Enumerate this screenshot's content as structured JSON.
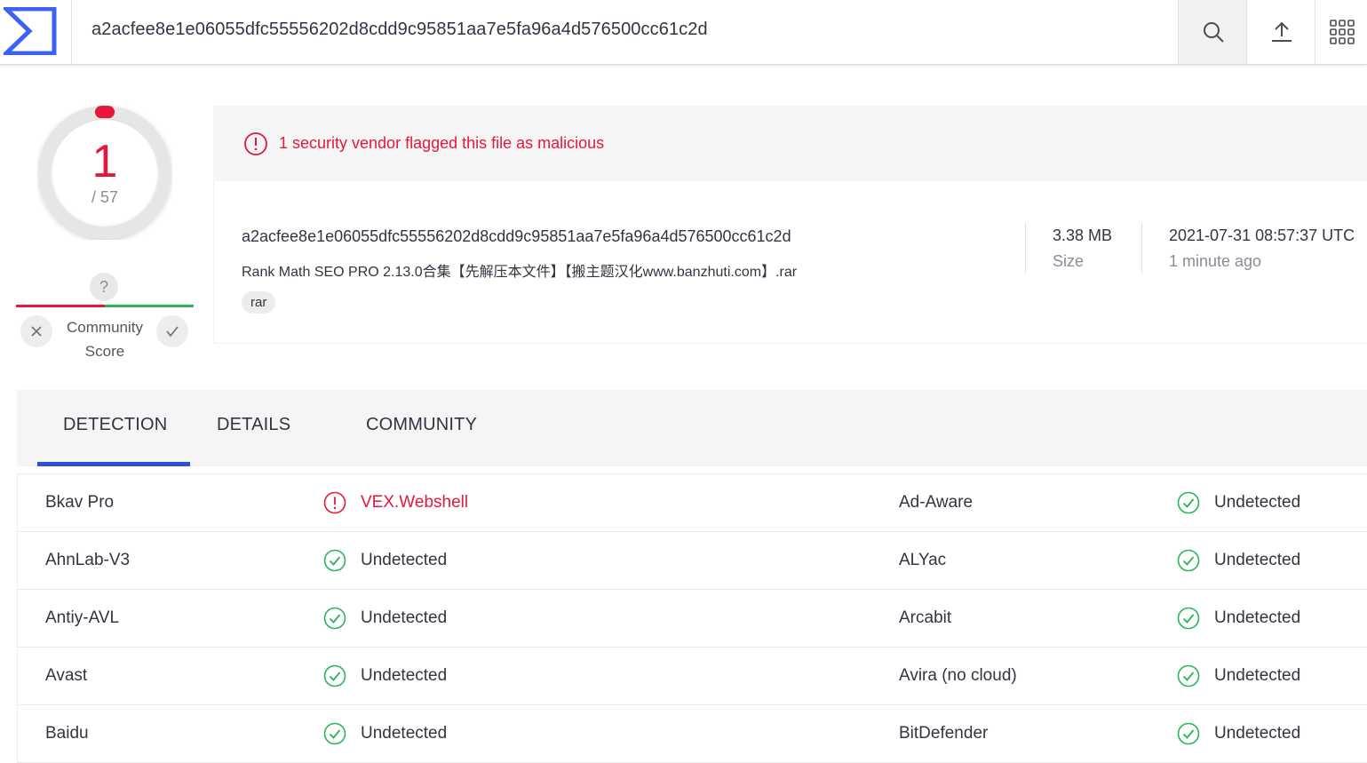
{
  "topbar": {
    "search_value": "a2acfee8e1e06055dfc55556202d8cdd9c95851aa7e5fa96a4d576500cc61c2d",
    "icons": [
      "logo-icon",
      "search-icon",
      "upload-icon",
      "apps-grid-icon"
    ]
  },
  "score": {
    "detections": "1",
    "total": "/ 57",
    "fraction": 0.0175
  },
  "community": {
    "question": "?",
    "label": "Community Score"
  },
  "alert": {
    "text": "1 security vendor flagged this file as malicious"
  },
  "file": {
    "hash": "a2acfee8e1e06055dfc55556202d8cdd9c95851aa7e5fa96a4d576500cc61c2d",
    "name": "Rank Math SEO PRO 2.13.0合集【先解压本文件】【搬主题汉化www.banzhuti.com】.rar",
    "tag": "rar",
    "size_value": "3.38 MB",
    "size_label": "Size",
    "date_value": "2021-07-31 08:57:37 UTC",
    "date_label": "1 minute ago"
  },
  "tabs": [
    "DETECTION",
    "DETAILS",
    "COMMUNITY"
  ],
  "colors": {
    "malicious": "#e5183c",
    "clean": "#2bb25a",
    "accent": "#2f4cdd"
  },
  "detections": [
    {
      "engine1": "Bkav Pro",
      "result1": "VEX.Webshell",
      "status1": "malicious",
      "engine2": "Ad-Aware",
      "result2": "Undetected",
      "status2": "clean"
    },
    {
      "engine1": "AhnLab-V3",
      "result1": "Undetected",
      "status1": "clean",
      "engine2": "ALYac",
      "result2": "Undetected",
      "status2": "clean"
    },
    {
      "engine1": "Antiy-AVL",
      "result1": "Undetected",
      "status1": "clean",
      "engine2": "Arcabit",
      "result2": "Undetected",
      "status2": "clean"
    },
    {
      "engine1": "Avast",
      "result1": "Undetected",
      "status1": "clean",
      "engine2": "Avira (no cloud)",
      "result2": "Undetected",
      "status2": "clean"
    },
    {
      "engine1": "Baidu",
      "result1": "Undetected",
      "status1": "clean",
      "engine2": "BitDefender",
      "result2": "Undetected",
      "status2": "clean"
    }
  ]
}
